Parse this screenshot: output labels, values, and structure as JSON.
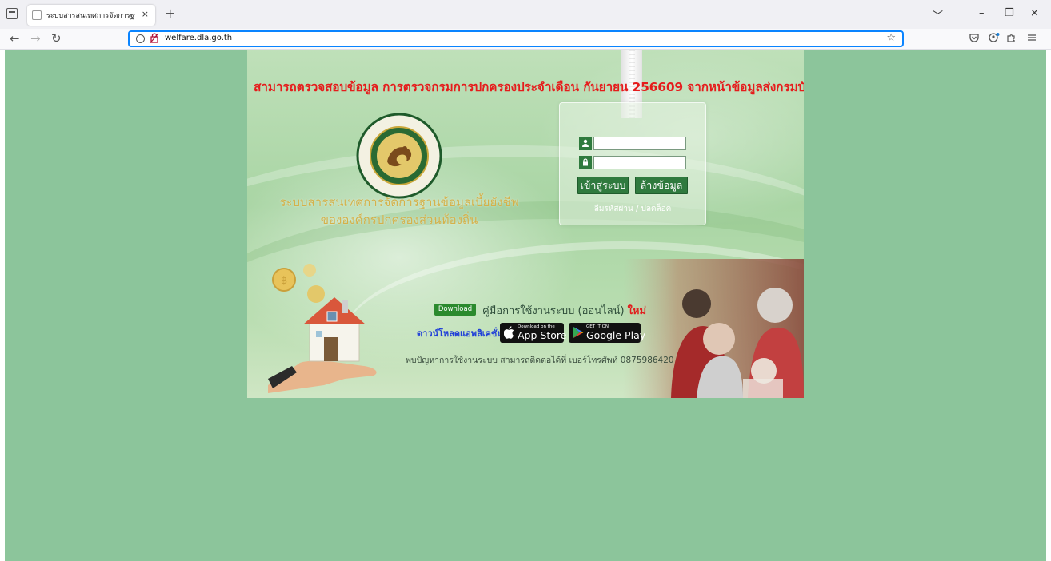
{
  "browser": {
    "tab_title": "ระบบสารสนเทศการจัดการฐานข้อมูลเบี้",
    "tab_close": "×",
    "new_tab": "+",
    "url": "welfare.dla.go.th",
    "window_controls": {
      "list_all_tabs": "﹀",
      "minimize": "–",
      "restore": "❐",
      "close": "×"
    },
    "nav": {
      "back": "←",
      "forward": "→",
      "reload": "↻"
    },
    "bookmark_star": "☆"
  },
  "page": {
    "background_color": "#8cc59b",
    "announcement": "สามารถตรวจสอบข้อมูล การตรวจกรมการปกครองประจำเดือน กันยายน 256609 จากหน้าข้อมูลส่งกรมบัญชีกลางได้",
    "emblem_text_th": "กรมส่งเสริมการปกครองท้องถิ่น",
    "emblem_text_en": "DEPARTMENT OF LOCAL ADMINISTRATION",
    "system_title_line1": "ระบบสารสนเทศการจัดการฐานข้อมูลเบี้ยยังชีพ",
    "system_title_line2": "ขององค์กรปกครองส่วนท้องถิ่น",
    "login": {
      "username_value": "",
      "password_value": "",
      "login_button": "เข้าสู่ระบบ",
      "clear_button": "ล้างข้อมูล",
      "forgot_link": "ลืมรหัสผ่าน / ปลดล็อค"
    },
    "download_badge": "Download",
    "manual_text": "คู่มือการใช้งานระบบ (ออนไลน์)",
    "manual_new": "ใหม่",
    "apps_label": "ดาวน์โหลดแอพลิเคชั่น",
    "app_store": {
      "small": "Download on the",
      "big": "App Store"
    },
    "google_play": {
      "small": "GET IT ON",
      "big": "Google Play"
    },
    "contact": "พบปัญหาการใช้งานระบบ สามารถติดต่อได้ที่ เบอร์โทรศัพท์ 0875986420"
  }
}
